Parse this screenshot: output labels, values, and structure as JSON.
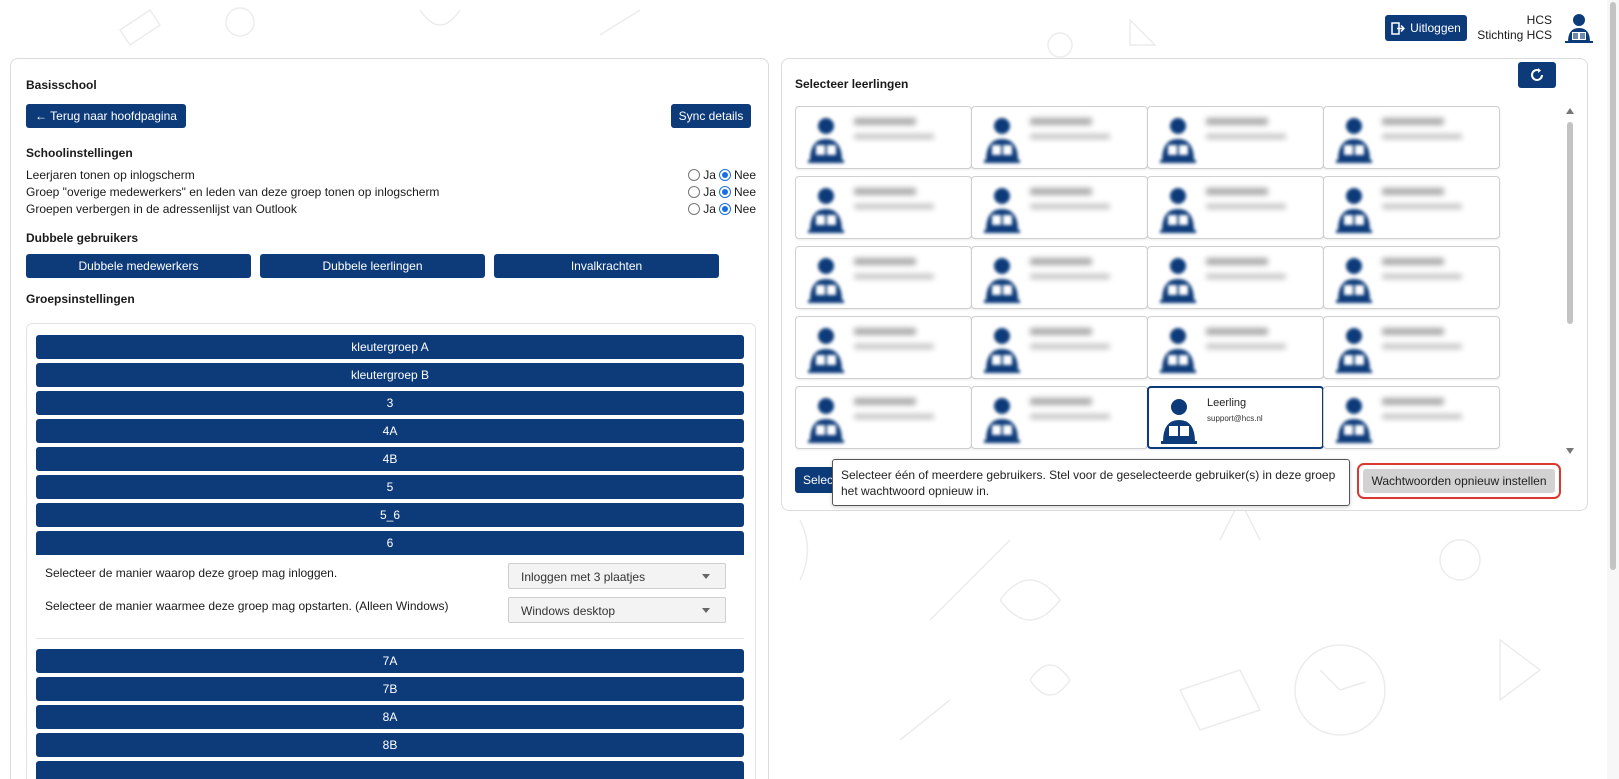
{
  "header": {
    "logout_label": "Uitloggen",
    "user_short": "HCS",
    "organization": "Stichting HCS"
  },
  "school": {
    "title": "Basisschool",
    "back_label": "← Terug naar hoofdpagina",
    "sync_label": "Sync details",
    "settings_heading": "Schoolinstellingen",
    "settings": [
      {
        "label": "Leerjaren tonen op inlogscherm",
        "yes": "Ja",
        "no": "Nee",
        "value": "Nee"
      },
      {
        "label": "Groep \"overige medewerkers\" en leden van deze groep tonen op inlogscherm",
        "yes": "Ja",
        "no": "Nee",
        "value": "Nee"
      },
      {
        "label": "Groepen verbergen in de adressenlijst van Outlook",
        "yes": "Ja",
        "no": "Nee",
        "value": "Nee"
      }
    ],
    "duplicates_heading": "Dubbele gebruikers",
    "duplicates_buttons": [
      "Dubbele medewerkers",
      "Dubbele leerlingen",
      "Invalkrachten"
    ],
    "groups_heading": "Groepsinstellingen",
    "groups": [
      "kleutergroep A",
      "kleutergroep B",
      "3",
      "4A",
      "4B",
      "5",
      "5_6",
      "6",
      "7A",
      "7B",
      "8A",
      "8B"
    ],
    "open_group": {
      "name": "6",
      "login_label": "Selecteer de manier waarop deze groep mag inloggen.",
      "login_value": "Inloggen met 3 plaatjes",
      "startup_label": "Selecteer de manier waarmee deze groep mag opstarten. (Alleen Windows)",
      "startup_value": "Windows desktop"
    }
  },
  "students_panel": {
    "title": "Selecteer leerlingen",
    "refresh_icon": "refresh-icon",
    "selected_card": {
      "name": "Leerling",
      "email": "support@hcs.nl"
    },
    "select_button_partial": "Selec",
    "tooltip": "Selecteer één of meerdere gebruikers. Stel voor de geselecteerde gebruiker(s) in deze groep het wachtwoord opnieuw in.",
    "reset_label": "Wachtwoorden opnieuw instellen"
  },
  "colors": {
    "primary": "#0d3b7a",
    "highlight": "#d9392e",
    "radio": "#1a6fe0"
  }
}
